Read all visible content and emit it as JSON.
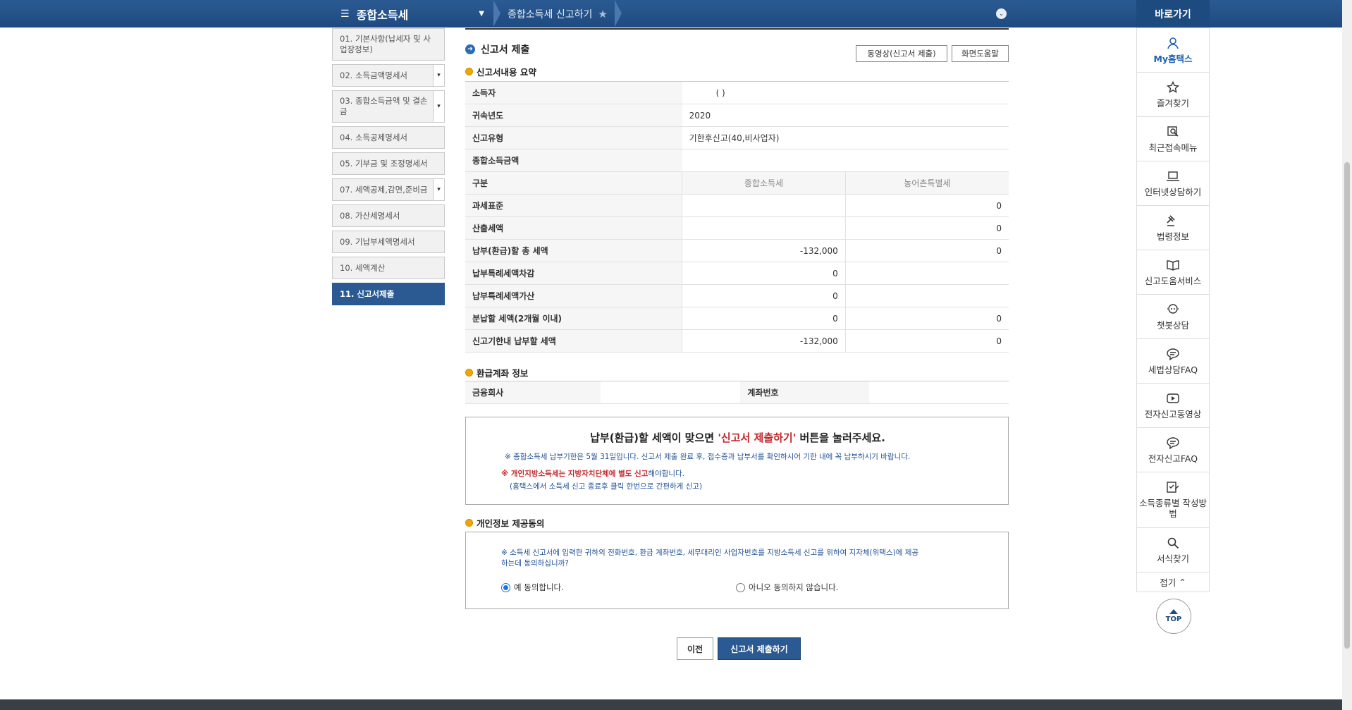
{
  "topbar": {
    "menu_title": "종합소득세",
    "breadcrumb": "종합소득세 신고하기",
    "quick_title": "바로가기"
  },
  "sidenav": [
    {
      "label": "01. 기본사항(납세자 및 사업장정보)",
      "active": false
    },
    {
      "label": "02. 소득금액명세서",
      "active": false
    },
    {
      "label": "03. 종합소득금액 및 결손금",
      "active": false
    },
    {
      "label": "04. 소득공제명세서",
      "active": false
    },
    {
      "label": "05. 기부금 및 조정명세서",
      "active": false
    },
    {
      "label": "07. 세액공제,감면,준비금",
      "active": false
    },
    {
      "label": "08. 가산세명세서",
      "active": false
    },
    {
      "label": "09. 기납부세액명세서",
      "active": false
    },
    {
      "label": "10. 세액계산",
      "active": false
    },
    {
      "label": "11. 신고서제출",
      "active": true
    }
  ],
  "main": {
    "title": "신고서 제출",
    "video_button": "동영상(신고서 제출)",
    "help_button": "화면도움말",
    "summary_title": "신고서내용 요약",
    "summary": {
      "taxpayer_label": "소득자",
      "taxpayer_value": "(                    )",
      "year_label": "귀속년도",
      "year_value": "2020",
      "type_label": "신고유형",
      "type_value": "기한후신고(40,비사업자)",
      "income_label": "종합소득금액",
      "income_value": "",
      "category_label": "구분",
      "col1": "종합소득세",
      "col2": "농어촌특별세",
      "rows": [
        {
          "label": "과세표준",
          "v1": "",
          "v2": "0"
        },
        {
          "label": "산출세액",
          "v1": "",
          "v2": "0"
        },
        {
          "label": "납부(환급)할 총 세액",
          "v1": "-132,000",
          "v2": "0"
        },
        {
          "label": "납부특례세액차감",
          "v1": "0",
          "v2": ""
        },
        {
          "label": "납부특례세액가산",
          "v1": "0",
          "v2": ""
        },
        {
          "label": "분납할 세액(2개월 이내)",
          "v1": "0",
          "v2": "0"
        },
        {
          "label": "신고기한내 납부할 세액",
          "v1": "-132,000",
          "v2": "0"
        }
      ]
    },
    "refund_title": "환급계좌 정보",
    "refund": {
      "bank_label": "금융회사",
      "bank_value": "",
      "account_label": "계좌번호",
      "account_value": ""
    },
    "notice": {
      "big_pre": "납부(환급)할 세액이 맞으면 ",
      "big_red": "'신고서 제출하기'",
      "big_post": " 버튼을 눌러주세요.",
      "line1": "※ 종합소득세 납부기한은 5월 31일입니다. 신고서 제출 완료 후, 접수증과 납부서를 확인하시어 기한 내에 꼭 납부하시기 바랍니다.",
      "line2_red": "※ 개인지방소득세는 지방자치단체에 별도 신고",
      "line2_post": "해야합니다.",
      "line3": "(홈택스에서 소득세 신고 종료후 클릭 한번으로 간편하게 신고)"
    },
    "consent_title": "개인정보 제공동의",
    "consent": {
      "text": "※ 소득세 신고서에 입력한 귀하의 전화번호, 환급 계좌번호, 세무대리인 사업자번호를 지방소득세 신고를 위하여 지자체(위택스)에 제공하는데 동의하십니까?",
      "yes": "예 동의합니다.",
      "no": "아니오 동의하지 않습니다."
    },
    "prev_button": "이전",
    "submit_button": "신고서 제출하기"
  },
  "quickbar": {
    "items": [
      "My홈택스",
      "즐겨찾기",
      "최근접속메뉴",
      "인터넷상담하기",
      "법령정보",
      "신고도움서비스",
      "챗봇상담",
      "세법상담FAQ",
      "전자신고동영상",
      "전자신고FAQ",
      "소득종류별 작성방법",
      "서식찾기"
    ],
    "fold": "접기",
    "top": "TOP"
  },
  "colors": {
    "primary": "#2b5a92",
    "accent_red": "#c0282d",
    "link_blue": "#1f4f96"
  }
}
